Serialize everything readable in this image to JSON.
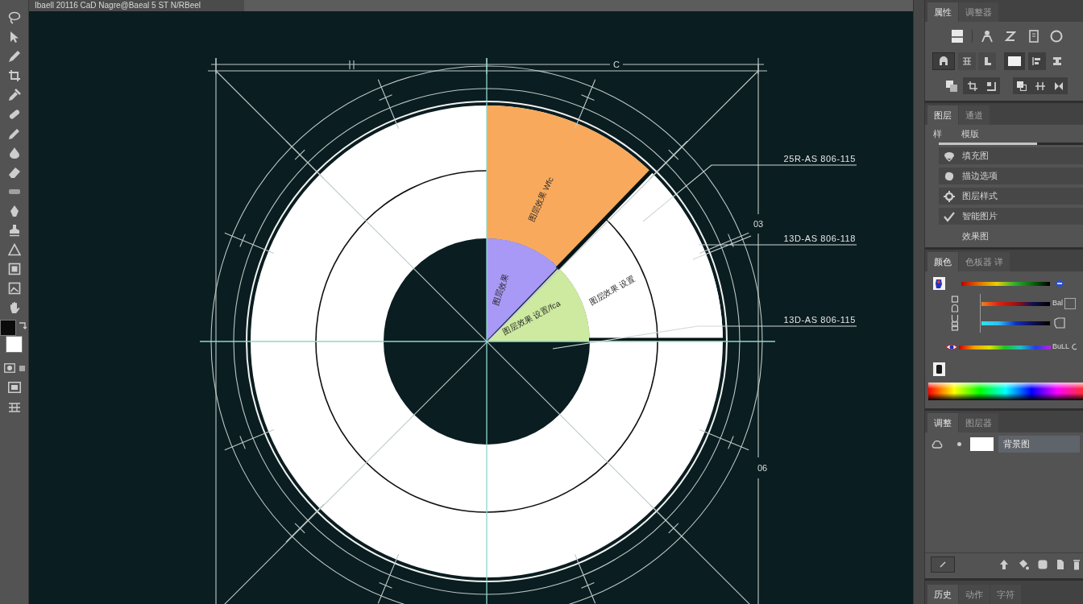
{
  "document_tab": {
    "title": "Ibaell 20116 CaD Nagre@Baeal 5 ST N/RBeel"
  },
  "swatches": [
    {
      "kind": "foreground",
      "color": "#0b0b0b"
    },
    {
      "kind": "background",
      "color": "#ffffff"
    }
  ],
  "canvas": {
    "dimension_labels": [
      "C",
      "03",
      "06"
    ],
    "segments": [
      {
        "label": "图层效果 Wfc",
        "color": "#f8a95b"
      },
      {
        "label": "图层效果",
        "color": "#a899f6"
      },
      {
        "label": "图层效果 设置/fca",
        "color": "#cdeaa0"
      },
      {
        "label": "图层效果 设置",
        "color": "#ffffff"
      }
    ],
    "callouts": [
      "25R-AS 806-115",
      "13D-AS 806-118",
      "13D-AS 806-115"
    ]
  },
  "properties_panel": {
    "tabs": [
      {
        "label": "属性",
        "selected": true
      },
      {
        "label": "调整器",
        "selected": false
      }
    ]
  },
  "styles_panel": {
    "tabs": [
      {
        "label": "图层",
        "selected": true
      },
      {
        "label": "通道",
        "selected": false
      }
    ],
    "filter_label": "样",
    "mode_label": "模版",
    "opacity": {
      "level": 0.68
    },
    "items": [
      {
        "kind": "effect",
        "label": "填充图"
      },
      {
        "kind": "effect",
        "label": "描边选项"
      },
      {
        "kind": "effect",
        "label": "图层样式"
      },
      {
        "kind": "effect",
        "label": "智能图片"
      },
      {
        "kind": "plain",
        "label": "效果图"
      }
    ]
  },
  "color_panel": {
    "tabs": [
      {
        "label": "颜色",
        "selected": true
      },
      {
        "label": "色板器 详",
        "selected": false
      }
    ],
    "readouts": [
      "Bal",
      "BuLL"
    ]
  },
  "layers_panel": {
    "tabs": [
      {
        "label": "调整",
        "selected": true
      },
      {
        "label": "图层器",
        "selected": false
      }
    ],
    "layers": [
      {
        "name": "背景图",
        "selected": true
      }
    ]
  },
  "bottom_tabs": [
    {
      "label": "历史",
      "selected": true
    },
    {
      "label": "动作",
      "selected": false
    },
    {
      "label": "字符",
      "selected": false
    }
  ]
}
